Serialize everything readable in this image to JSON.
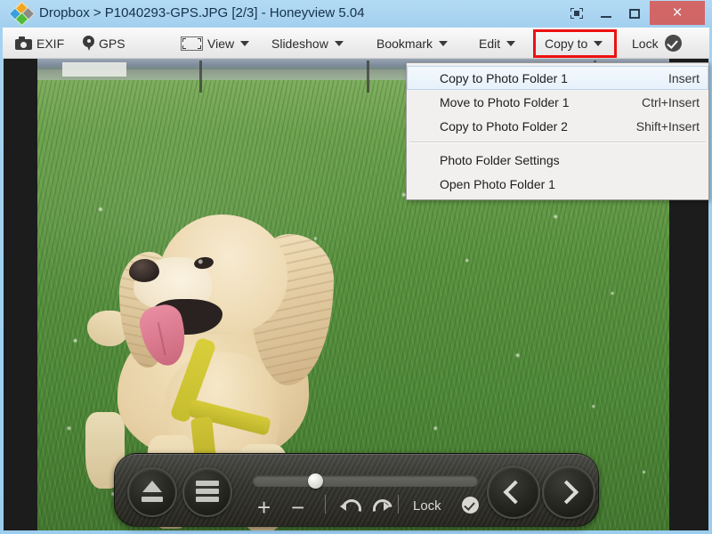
{
  "window": {
    "title": "Dropbox > P1040293-GPS.JPG [2/3] - Honeyview 5.04",
    "app_icon": "dropbox-diamond-icon",
    "controls": {
      "fullscreen_label": "",
      "minimize_label": "",
      "maximize_label": "",
      "close_label": "×"
    },
    "colors": {
      "titlebar": "#a3d0ef",
      "close_button": "#d9534f",
      "highlight": "#ee1111",
      "toolbar": "#eeeeee"
    }
  },
  "toolbar": {
    "items": [
      {
        "label": "EXIF",
        "icon": "camera-icon",
        "has_caret": false
      },
      {
        "label": "GPS",
        "icon": "map-pin-icon",
        "has_caret": false
      },
      {
        "label": "View",
        "icon": "fit-frame-icon",
        "has_caret": true
      },
      {
        "label": "Slideshow",
        "icon": "",
        "has_caret": true
      },
      {
        "label": "Bookmark",
        "icon": "",
        "has_caret": true
      },
      {
        "label": "Edit",
        "icon": "",
        "has_caret": true
      },
      {
        "label": "Copy to",
        "icon": "",
        "has_caret": true
      },
      {
        "label": "Lock",
        "icon": "check-badge-icon",
        "has_caret": false
      }
    ],
    "highlighted_item": "Copy to"
  },
  "menu": {
    "open_for": "Copy to",
    "groups": [
      {
        "items": [
          {
            "label": "Copy to Photo Folder 1",
            "accel": "Insert",
            "selected": true
          },
          {
            "label": "Move to Photo Folder 1",
            "accel": "Ctrl+Insert",
            "selected": false
          },
          {
            "label": "Copy to Photo Folder 2",
            "accel": "Shift+Insert",
            "selected": false
          }
        ]
      },
      {
        "items": [
          {
            "label": "Photo Folder Settings",
            "accel": "",
            "selected": false
          },
          {
            "label": "Open Photo Folder 1",
            "accel": "",
            "selected": false
          }
        ]
      }
    ]
  },
  "photo": {
    "description": "Cream cocker spaniel standing on a clover-covered grass field with a yellow harness, distant treeline and fence posts on the horizon",
    "letterbox_color": "#1c1c1c"
  },
  "control_bar": {
    "eject_label": "",
    "menu_label": "",
    "zoom_in_label": "+",
    "zoom_out_label": "−",
    "rotate_ccw_label": "",
    "rotate_cw_label": "",
    "lock_label": "Lock",
    "prev_label": "",
    "next_label": "",
    "slider_value": 25
  }
}
